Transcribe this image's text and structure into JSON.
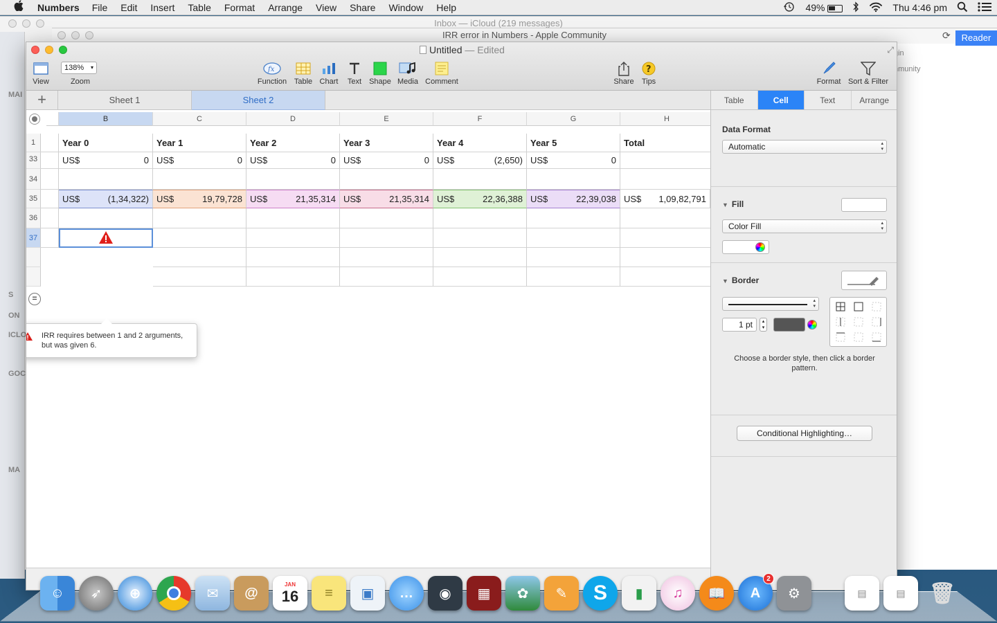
{
  "menubar": {
    "apple": "",
    "app_name": "Numbers",
    "items": [
      "File",
      "Edit",
      "Insert",
      "Table",
      "Format",
      "Arrange",
      "View",
      "Share",
      "Window",
      "Help"
    ],
    "battery": "49%",
    "clock": "Thu 4:46 pm"
  },
  "bg_mail": {
    "title": "Inbox — iCloud (219 messages)",
    "sidebar_labels": [
      "MAI",
      "S",
      "ON",
      "ICLO",
      "GOC",
      "MA"
    ]
  },
  "bg_safari": {
    "title": "IRR error in Numbers - Apple Community",
    "reader": "Reader",
    "login": "gin",
    "community": "nmunity"
  },
  "window": {
    "doc_name": "Untitled",
    "doc_state": "— Edited",
    "zoom_value": "138%"
  },
  "toolbar": {
    "view": "View",
    "zoom": "Zoom",
    "function": "Function",
    "table": "Table",
    "chart": "Chart",
    "text": "Text",
    "shape": "Shape",
    "media": "Media",
    "comment": "Comment",
    "share": "Share",
    "tips": "Tips",
    "format": "Format",
    "sort_filter": "Sort & Filter"
  },
  "sheets": {
    "add": "+",
    "tabs": [
      "Sheet 1",
      "Sheet 2"
    ],
    "active": "Sheet 2"
  },
  "grid": {
    "columns": [
      "B",
      "C",
      "D",
      "E",
      "F",
      "G",
      "H"
    ],
    "selected_column": "B",
    "rows": {
      "r1": {
        "num": "1",
        "cells": [
          "Year 0",
          "Year 1",
          "Year 2",
          "Year 3",
          "Year 4",
          "Year 5",
          "Total"
        ]
      },
      "r33": {
        "num": "33",
        "currency": "US$",
        "values": [
          "0",
          "0",
          "0",
          "0",
          "(2,650)",
          "0",
          ""
        ]
      },
      "r34": {
        "num": "34"
      },
      "r35": {
        "num": "35",
        "currency": "US$",
        "values": [
          "(1,34,322)",
          "19,79,728",
          "21,35,314",
          "21,35,314",
          "22,36,388",
          "22,39,038",
          "1,09,82,791"
        ]
      },
      "r36": {
        "num": "36"
      },
      "r37": {
        "num": "37"
      }
    },
    "row35_colors": [
      "#dde3f8",
      "#fbe3d3",
      "#f6dcf3",
      "#f8dde7",
      "#dff1d6",
      "#ebddf7",
      "#ffffff"
    ],
    "error_message": "IRR requires between 1 and 2 arguments, but was given 6."
  },
  "inspector": {
    "tabs": [
      "Table",
      "Cell",
      "Text",
      "Arrange"
    ],
    "active_tab": "Cell",
    "data_format_label": "Data Format",
    "data_format_value": "Automatic",
    "fill_label": "Fill",
    "fill_value": "Color Fill",
    "border_label": "Border",
    "border_width": "1 pt",
    "border_hint": "Choose a border style, then click a border pattern.",
    "conditional_button": "Conditional Highlighting…"
  },
  "dock": {
    "icons": [
      "finder-icon",
      "launchpad-icon",
      "safari-icon",
      "chrome-icon",
      "mail-icon",
      "contacts-icon",
      "calendar-icon",
      "notes-icon",
      "preview-icon",
      "messages-icon",
      "facetime-icon",
      "photo-booth-icon",
      "iphoto-icon",
      "pages-icon",
      "skype-icon",
      "numbers-icon",
      "itunes-icon",
      "ibooks-icon",
      "app-store-icon",
      "system-preferences-icon",
      "document-icon",
      "document-icon",
      "trash-icon"
    ],
    "calendar_day": "16",
    "calendar_month": "JAN",
    "app_store_badge": "2"
  }
}
